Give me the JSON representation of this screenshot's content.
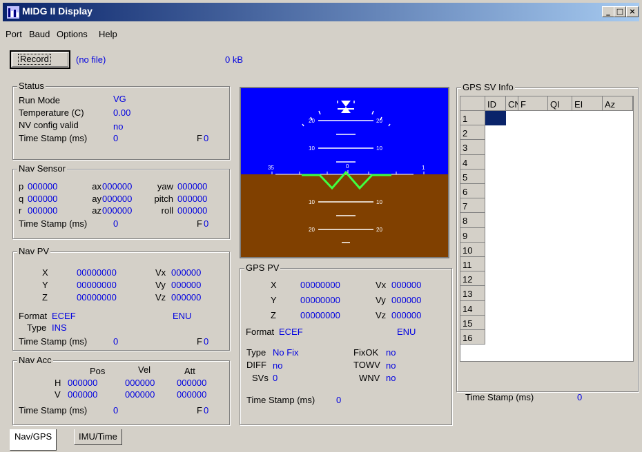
{
  "window": {
    "title": "MIDG II Display",
    "controls": [
      "minimize",
      "maximize",
      "close"
    ]
  },
  "menu": [
    "Port",
    "Baud",
    "Options",
    "Help"
  ],
  "toolbar": {
    "record_label": "Record",
    "file": "(no file)",
    "size": "0 kB"
  },
  "status": {
    "title": "Status",
    "run_mode_label": "Run Mode",
    "run_mode": "VG",
    "temperature_label": "Temperature (C)",
    "temperature": "0.00",
    "nv_label": "NV config valid",
    "nv": "no",
    "ts_label": "Time Stamp (ms)",
    "ts": "0",
    "f_label": "F",
    "f": "0"
  },
  "nav_sensor": {
    "title": "Nav Sensor",
    "rows": [
      {
        "l1": "p",
        "v1": "000000",
        "l2": "ax",
        "v2": "000000",
        "l3": "yaw",
        "v3": "000000"
      },
      {
        "l1": "q",
        "v1": "000000",
        "l2": "ay",
        "v2": "000000",
        "l3": "pitch",
        "v3": "000000"
      },
      {
        "l1": "r",
        "v1": "000000",
        "l2": "az",
        "v2": "000000",
        "l3": "roll",
        "v3": "000000"
      }
    ],
    "ts_label": "Time Stamp (ms)",
    "ts": "0",
    "f_label": "F",
    "f": "0"
  },
  "nav_pv": {
    "title": "Nav PV",
    "rows": [
      {
        "l": "X",
        "v": "00000000",
        "vl": "Vx",
        "vv": "000000"
      },
      {
        "l": "Y",
        "v": "00000000",
        "vl": "Vy",
        "vv": "000000"
      },
      {
        "l": "Z",
        "v": "00000000",
        "vl": "Vz",
        "vv": "000000"
      }
    ],
    "format_label": "Format",
    "format": "ECEF",
    "frame": "ENU",
    "type_label": "Type",
    "type": "INS",
    "ts_label": "Time Stamp (ms)",
    "ts": "0",
    "f_label": "F",
    "f": "0"
  },
  "nav_acc": {
    "title": "Nav Acc",
    "cols": [
      "Pos",
      "Vel",
      "Att"
    ],
    "rows": [
      {
        "l": "H",
        "vals": [
          "000000",
          "000000",
          "000000"
        ]
      },
      {
        "l": "V",
        "vals": [
          "000000",
          "000000",
          "000000"
        ]
      }
    ],
    "ts_label": "Time Stamp (ms)",
    "ts": "0",
    "f_label": "F",
    "f": "0"
  },
  "attitude": {
    "sky_color": "#0000ff",
    "ground_color": "#804000",
    "horizon_color": "#40ff40",
    "pitch_labels": [
      "20",
      "10",
      "10",
      "20"
    ],
    "heading_labels": [
      "35",
      "0",
      "1"
    ]
  },
  "gps_pv": {
    "title": "GPS PV",
    "rows": [
      {
        "l": "X",
        "v": "00000000",
        "vl": "Vx",
        "vv": "000000"
      },
      {
        "l": "Y",
        "v": "00000000",
        "vl": "Vy",
        "vv": "000000"
      },
      {
        "l": "Z",
        "v": "00000000",
        "vl": "Vz",
        "vv": "000000"
      }
    ],
    "format_label": "Format",
    "format": "ECEF",
    "frame": "ENU",
    "type_label": "Type",
    "type": "No Fix",
    "diff_label": "DIFF",
    "diff": "no",
    "svs_label": "SVs",
    "svs": "0",
    "fixok_label": "FixOK",
    "fixok": "no",
    "tow_label": "TOWV",
    "tow": "no",
    "wn_label": "WNV",
    "wn": "no",
    "ts_label": "Time Stamp (ms)",
    "ts": "0"
  },
  "gps_sv": {
    "title": "GPS SV Info",
    "columns": [
      "ID",
      "CN",
      "F",
      "QI",
      "EI",
      "Az"
    ],
    "rows": [
      "1",
      "2",
      "3",
      "4",
      "5",
      "6",
      "7",
      "8",
      "9",
      "10",
      "11",
      "12",
      "13",
      "14",
      "15",
      "16"
    ],
    "ts_label": "Time Stamp (ms)",
    "ts": "0"
  },
  "tabs": [
    "Nav/GPS",
    "IMU/Time"
  ]
}
